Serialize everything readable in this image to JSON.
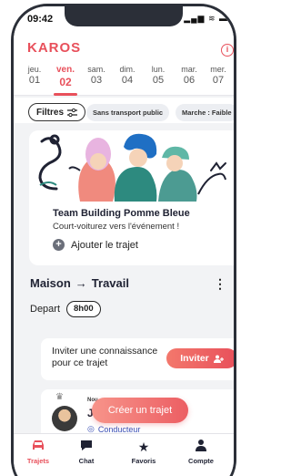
{
  "status": {
    "time": "09:42",
    "icons": "▂▄▆ ≋ ▬"
  },
  "header": {
    "logo": "KAROS",
    "info_icon": "i"
  },
  "days": [
    {
      "name": "jeu.",
      "num": "01",
      "active": false
    },
    {
      "name": "ven.",
      "num": "02",
      "active": true
    },
    {
      "name": "sam.",
      "num": "03",
      "active": false
    },
    {
      "name": "dim.",
      "num": "04",
      "active": false
    },
    {
      "name": "lun.",
      "num": "05",
      "active": false
    },
    {
      "name": "mar.",
      "num": "06",
      "active": false
    },
    {
      "name": "mer.",
      "num": "07",
      "active": false
    }
  ],
  "filters": {
    "button_label": "Filtres",
    "chips": [
      "Sans transport public",
      "Marche : Faible"
    ]
  },
  "event": {
    "title": "Team Building Pomme Bleue",
    "subtitle": "Court-voiturez vers l'événement !",
    "add_label": "Ajouter le trajet"
  },
  "trip": {
    "from": "Maison",
    "arrow": "→",
    "to": "Travail",
    "depart_label": "Depart",
    "depart_time": "8h00"
  },
  "invite": {
    "text": "Inviter une connaissance pour ce trajet",
    "button": "Inviter"
  },
  "driver": {
    "badge": "Nou",
    "initial": "J",
    "role": "Conducteur"
  },
  "create_button": "Créer un trajet",
  "tabs": [
    {
      "label": "Trajets",
      "active": true
    },
    {
      "label": "Chat",
      "active": false
    },
    {
      "label": "Favoris",
      "active": false
    },
    {
      "label": "Compte",
      "active": false
    }
  ],
  "colors": {
    "accent": "#e8505b",
    "teal": "#2d8a7f",
    "text": "#1f2233"
  }
}
